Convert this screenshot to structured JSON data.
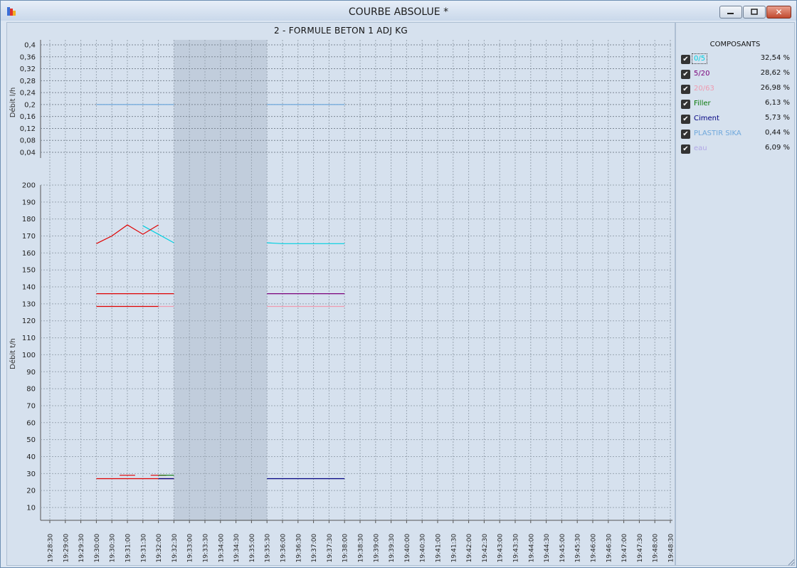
{
  "window": {
    "title": "COURBE ABSOLUE *",
    "buttons": {
      "minimize": "minimize-icon",
      "maximize": "restore-icon",
      "close": "close-icon"
    }
  },
  "chart": {
    "title": "2 - FORMULE BETON 1 ADJ KG",
    "shaded_interval": [
      "19:32:30",
      "19:35:30"
    ]
  },
  "legend": {
    "title": "COMPOSANTS",
    "items": [
      {
        "name": "0/5",
        "pct": "32,54 %",
        "color": "#00cfe0",
        "checked": true,
        "focused": true
      },
      {
        "name": "5/20",
        "pct": "28,62 %",
        "color": "#7a007a",
        "checked": true
      },
      {
        "name": "20/63",
        "pct": "26,98 %",
        "color": "#f09ab0",
        "checked": true
      },
      {
        "name": "Filler",
        "pct": "6,13 %",
        "color": "#0a7a0a",
        "checked": true
      },
      {
        "name": "Ciment",
        "pct": "5,73 %",
        "color": "#000080",
        "checked": true
      },
      {
        "name": "PLASTIR SIKA",
        "pct": "0,44 %",
        "color": "#6fa8dc",
        "checked": true
      },
      {
        "name": "eau",
        "pct": "6,09 %",
        "color": "#b0a6e6",
        "checked": true
      }
    ]
  },
  "chart_data": [
    {
      "type": "line",
      "ylabel": "Débit l/h",
      "ylim": [
        0.04,
        0.4
      ],
      "yticks": [
        "0,4",
        "0,36",
        "0,32",
        "0,28",
        "0,24",
        "0,2",
        "0,16",
        "0,12",
        "0,08",
        "0,04"
      ],
      "series": [
        {
          "name": "PLASTIR SIKA",
          "color": "#6fa8dc",
          "segments": [
            {
              "x": [
                "19:30:00",
                "19:32:30"
              ],
              "y": [
                0.2,
                0.2
              ]
            },
            {
              "x": [
                "19:35:30",
                "19:38:00"
              ],
              "y": [
                0.2,
                0.2
              ]
            }
          ]
        }
      ]
    },
    {
      "type": "line",
      "ylabel": "Débit t/h",
      "ylim": [
        0,
        200
      ],
      "yticks": [
        "200",
        "190",
        "180",
        "170",
        "160",
        "150",
        "140",
        "130",
        "120",
        "110",
        "100",
        "90",
        "80",
        "70",
        "60",
        "50",
        "40",
        "30",
        "20",
        "10"
      ],
      "xticks": [
        "19:28:30",
        "19:29:00",
        "19:29:30",
        "19:30:00",
        "19:30:30",
        "19:31:00",
        "19:31:30",
        "19:32:00",
        "19:32:30",
        "19:33:00",
        "19:33:30",
        "19:34:00",
        "19:34:30",
        "19:35:00",
        "19:35:30",
        "19:36:00",
        "19:36:30",
        "19:37:00",
        "19:37:30",
        "19:38:00",
        "19:38:30",
        "19:39:00",
        "19:39:30",
        "19:40:00",
        "19:40:30",
        "19:41:00",
        "19:41:30",
        "19:42:00",
        "19:42:30",
        "19:43:00",
        "19:43:30",
        "19:44:00",
        "19:44:30",
        "19:45:00",
        "19:45:30",
        "19:46:00",
        "19:46:30",
        "19:47:00",
        "19:47:30",
        "19:48:00",
        "19:48:30"
      ],
      "series": [
        {
          "name": "0/5",
          "color": "#00cfe0",
          "segments": [
            {
              "x": [
                "19:31:30",
                "19:32:30"
              ],
              "y": [
                176,
                166
              ]
            },
            {
              "x": [
                "19:35:30",
                "19:36:00",
                "19:38:00"
              ],
              "y": [
                166,
                165.5,
                165.5
              ]
            }
          ]
        },
        {
          "name": "0/5 (red)",
          "color": "#e00000",
          "segments": [
            {
              "x": [
                "19:30:00",
                "19:30:30",
                "19:31:00",
                "19:31:30",
                "19:32:00"
              ],
              "y": [
                165.5,
                170,
                176.5,
                171,
                176.5
              ]
            },
            {
              "x": [
                "19:30:00",
                "19:32:30"
              ],
              "y": [
                136,
                136
              ]
            },
            {
              "x": [
                "19:30:00",
                "19:32:00"
              ],
              "y": [
                128.5,
                128.5
              ]
            },
            {
              "x": [
                "19:30:00",
                "19:32:30"
              ],
              "y": [
                27,
                27
              ]
            },
            {
              "x": [
                "19:30:45",
                "19:31:15"
              ],
              "y": [
                29,
                29
              ]
            },
            {
              "x": [
                "19:31:45",
                "19:32:15"
              ],
              "y": [
                29,
                29
              ]
            }
          ]
        },
        {
          "name": "5/20",
          "color": "#7a007a",
          "segments": [
            {
              "x": [
                "19:35:30",
                "19:38:00"
              ],
              "y": [
                136,
                136
              ]
            }
          ]
        },
        {
          "name": "20/63",
          "color": "#f09ab0",
          "segments": [
            {
              "x": [
                "19:32:00",
                "19:32:30"
              ],
              "y": [
                128.5,
                128.5
              ]
            },
            {
              "x": [
                "19:35:30",
                "19:38:00"
              ],
              "y": [
                128.5,
                128.5
              ]
            }
          ]
        },
        {
          "name": "Filler",
          "color": "#0a7a0a",
          "segments": [
            {
              "x": [
                "19:32:00",
                "19:32:30"
              ],
              "y": [
                29,
                29
              ]
            }
          ]
        },
        {
          "name": "Ciment",
          "color": "#000080",
          "segments": [
            {
              "x": [
                "19:32:00",
                "19:32:30"
              ],
              "y": [
                27,
                27
              ]
            },
            {
              "x": [
                "19:35:30",
                "19:38:00"
              ],
              "y": [
                27,
                27
              ]
            }
          ]
        }
      ]
    }
  ]
}
